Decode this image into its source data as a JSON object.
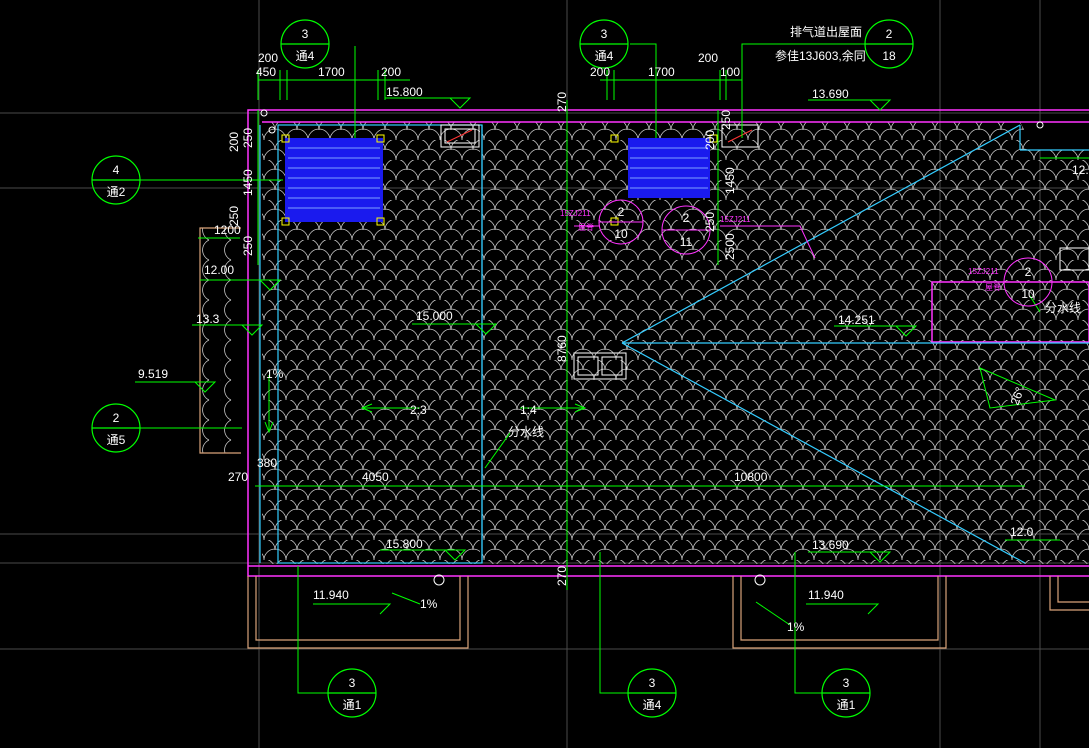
{
  "colors": {
    "background": "#000000",
    "grid": "#555555",
    "green": "#00ff00",
    "magenta": "#ff33ff",
    "cyan": "#33ccff",
    "white": "#ffffff",
    "blue": "#2222ff",
    "yellow": "#ffff00",
    "tan": "#d9a47a"
  },
  "title_note": {
    "line1": "排气道出屋面",
    "line2": "参佳13J603,余同"
  },
  "dims_top_left": [
    "450",
    "200",
    "1700",
    "200"
  ],
  "dims_top_mid": [
    "200",
    "1700",
    "200",
    "100"
  ],
  "dims_left": [
    "250",
    "200",
    "1450",
    "250",
    "1200",
    "250"
  ],
  "dims_mid": [
    "250",
    "200",
    "1450",
    "250",
    "2500"
  ],
  "dim_bottom": [
    "380",
    "4050",
    "10800"
  ],
  "dim_vertical": [
    "270",
    "8760",
    "270"
  ],
  "dim_side_270": "270",
  "elevations": {
    "top_left": "15.800",
    "top_right": "13.690",
    "mid_left_a": "12.00",
    "mid_left_b": "13.3",
    "mid_left_c": "9.519",
    "mid_left_d": "12.00",
    "mid_center": "15.000",
    "mid_right": "14.251",
    "right_top": "12.",
    "right_bottom": "12.0",
    "bottom_left": "15.800",
    "bottom_right": "13.690",
    "canopy_left": "11.940",
    "canopy_right": "11.940"
  },
  "slopes": {
    "left_vertical": "1%",
    "ratio_left": "2:3",
    "ratio_mid": "1:4",
    "angle": "26°",
    "canopy_left": "1%",
    "canopy_right": "1%"
  },
  "notes": {
    "split_line_a": "分水线",
    "split_line_b": "分水线",
    "detail_ref_a": "15ZJ211",
    "detail_ref_b": "15ZJ211",
    "detail_ref_c": "15ZJ211",
    "detail_sub": "屋脊"
  },
  "detail_callouts": [
    {
      "top": "3",
      "bottom": "通4"
    },
    {
      "top": "3",
      "bottom": "通4"
    },
    {
      "top": "2",
      "bottom": "18"
    },
    {
      "top": "4",
      "bottom": "通2"
    },
    {
      "top": "2",
      "bottom": "通5"
    },
    {
      "top": "3",
      "bottom": "通1"
    },
    {
      "top": "3",
      "bottom": "通4"
    },
    {
      "top": "3",
      "bottom": "通1"
    }
  ],
  "mag_callouts": [
    {
      "top": "2",
      "bottom": "10"
    },
    {
      "top": "2",
      "bottom": "11"
    },
    {
      "top": "2",
      "bottom": "10"
    }
  ]
}
